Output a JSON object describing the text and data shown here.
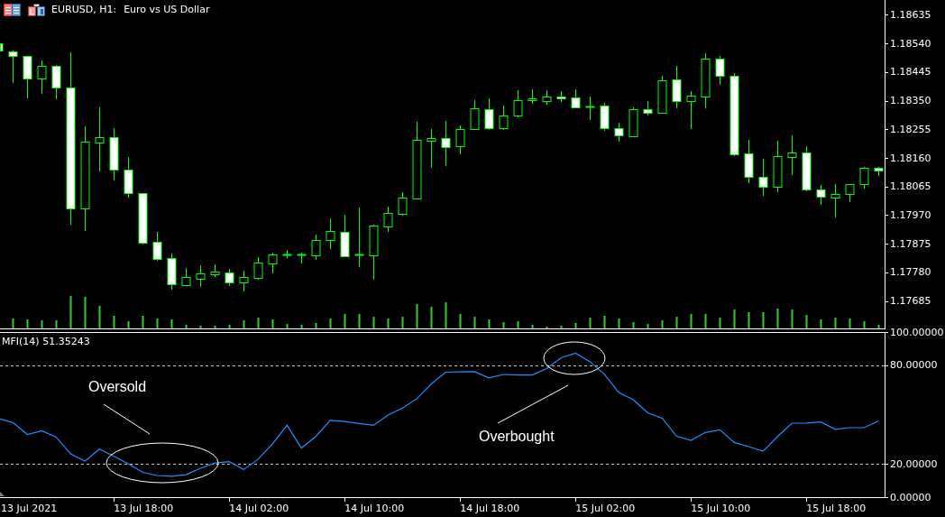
{
  "chart_header": {
    "symbol": "EURUSD, H1:",
    "description": "Euro vs US Dollar"
  },
  "price_axis": {
    "labels": [
      "1.18635",
      "1.18540",
      "1.18445",
      "1.18350",
      "1.18255",
      "1.18160",
      "1.18065",
      "1.17970",
      "1.17875",
      "1.17780",
      "1.17685"
    ]
  },
  "indicator_pane": {
    "chart_data": {
      "type": "line",
      "title": "MFI(14) 51.35243",
      "values": [
        47.3,
        45.2,
        38.0,
        40.2,
        36.4,
        26.2,
        21.8,
        29.1,
        24.7,
        20.2,
        15.0,
        13.1,
        12.7,
        13.6,
        17.5,
        20.7,
        21.5,
        16.7,
        23.0,
        32.3,
        43.5,
        29.8,
        36.8,
        46.5,
        45.8,
        44.6,
        43.5,
        49.8,
        54.0,
        59.6,
        68.6,
        75.7,
        75.9,
        76.0,
        72.2,
        74.3,
        74.0,
        74.0,
        77.8,
        84.4,
        87.2,
        82.0,
        74.4,
        63.4,
        59.0,
        51.1,
        47.8,
        36.9,
        34.4,
        39.2,
        40.8,
        33.1,
        30.6,
        27.8,
        36.7,
        44.8,
        44.9,
        45.5,
        41.1,
        42.1,
        42.1,
        46.2
      ],
      "ylim": [
        0,
        100
      ],
      "yticks": [
        {
          "value": 100,
          "label": "100.00000"
        },
        {
          "value": 80,
          "label": "80.00000"
        },
        {
          "value": 20,
          "label": "20.00000"
        },
        {
          "value": 0,
          "label": "0.00000"
        }
      ],
      "annotations": [
        {
          "text": "Oversold"
        },
        {
          "text": "Overbought"
        }
      ]
    }
  },
  "time_axis": {
    "labels": [
      "13 Jul 2021",
      "13 Jul 18:00",
      "14 Jul 02:00",
      "14 Jul 10:00",
      "14 Jul 18:00",
      "15 Jul 02:00",
      "15 Jul 10:00",
      "15 Jul 18:00"
    ]
  }
}
